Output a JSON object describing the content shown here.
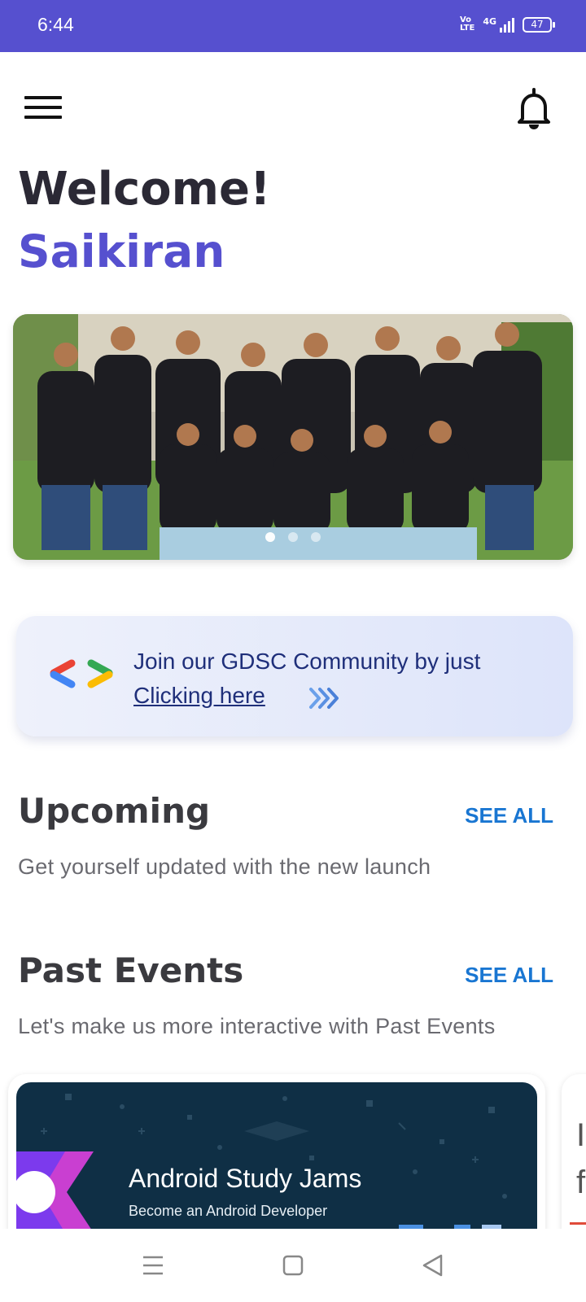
{
  "status_bar": {
    "time": "6:44",
    "volte_top": "Vo",
    "volte_bottom": "LTE",
    "network": "4G",
    "battery": "47"
  },
  "header": {
    "menu_icon": "hamburger-menu-icon",
    "notification_icon": "bell-icon"
  },
  "greeting": {
    "welcome": "Welcome!",
    "user_name": "Saikiran"
  },
  "carousel": {
    "image": "group-photo",
    "dot_count": 3,
    "active_index": 0
  },
  "gdsc_banner": {
    "line1": "Join our GDSC Community by just",
    "link_text": "Clicking here",
    "logo_icon": "gdsc-logo-icon",
    "arrow_icon": "double-chevron-right-icon"
  },
  "upcoming": {
    "title": "Upcoming",
    "see_all": "SEE ALL",
    "subtitle": "Get yourself updated with the new launch"
  },
  "past_events": {
    "title": "Past Events",
    "see_all": "SEE ALL",
    "subtitle": "Let's make us more interactive with Past Events",
    "cards": [
      {
        "title": "Android Study Jams",
        "subtitle": "Become an Android Developer"
      }
    ],
    "next_card_peek": "I\nf"
  },
  "nav_bar": {
    "recents_icon": "recents-icon",
    "home_icon": "home-icon",
    "back_icon": "back-icon"
  },
  "colors": {
    "primary": "#5650cf",
    "link_blue": "#1976d2",
    "banner_text": "#1f2f7a"
  }
}
